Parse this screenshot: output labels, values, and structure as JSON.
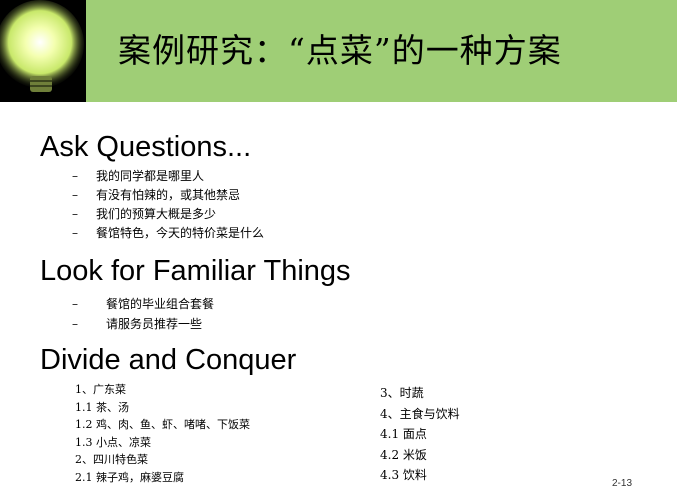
{
  "slide": {
    "title": "案例研究：“点菜”的一种方案",
    "sections": [
      {
        "heading": "Ask Questions...",
        "bullets": [
          "我的同学都是哪里人",
          "有没有怕辣的，或其他禁忌",
          "我们的预算大概是多少",
          "餐馆特色，今天的特价菜是什么"
        ]
      },
      {
        "heading": "Look for Familiar Things",
        "bullets": [
          "餐馆的毕业组合套餐",
          "请服务员推荐一些"
        ]
      },
      {
        "heading": "Divide and Conquer",
        "menu_left": [
          "1、广东菜",
          "1.1 茶、汤",
          "1.2 鸡、肉、鱼、虾、啫啫、下饭菜",
          "1.3 小点、凉菜",
          "2、四川特色菜",
          "2.1 辣子鸡，麻婆豆腐"
        ],
        "menu_right": [
          "3、时蔬",
          "4、主食与饮料",
          "4.1 面点",
          "4.2 米饭",
          "4.3 饮料"
        ]
      }
    ],
    "bullet_marker": "–",
    "page_number": "2-13"
  },
  "colors": {
    "header_band": "#9fce76",
    "header_left": "#000000",
    "bulb_glow": "#f4ffb0"
  },
  "icons": {
    "header_graphic": "light-bulb-icon"
  }
}
